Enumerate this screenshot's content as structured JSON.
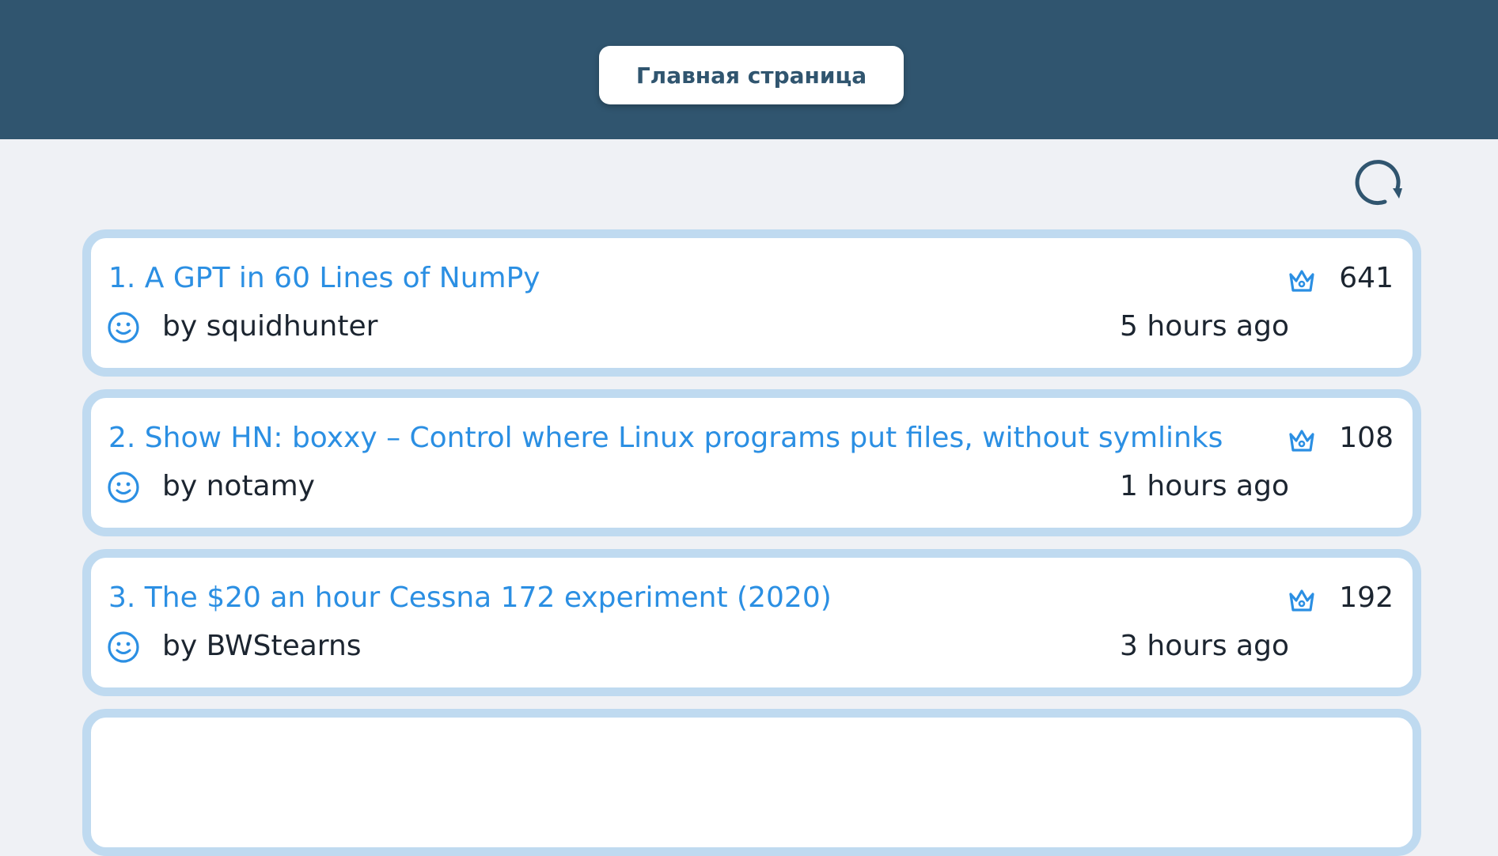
{
  "header": {
    "home_label": "Главная страница"
  },
  "colors": {
    "header_bg": "#30556f",
    "page_bg": "#eff1f5",
    "card_border": "#bfdaf0",
    "link": "#2b8fe3",
    "text": "#1c2530"
  },
  "icons": {
    "refresh": "refresh-icon",
    "score": "crown-icon",
    "author": "smiley-icon"
  },
  "stories": [
    {
      "title": "1. A GPT in 60 Lines of NumPy",
      "score": "641",
      "author": "by squidhunter",
      "time": "5 hours ago"
    },
    {
      "title": "2. Show HN: boxxy – Control where Linux programs put files, without symlinks",
      "score": "108",
      "author": "by notamy",
      "time": "1 hours ago"
    },
    {
      "title": "3. The $20 an hour Cessna 172 experiment (2020)",
      "score": "192",
      "author": "by BWStearns",
      "time": "3 hours ago"
    }
  ]
}
